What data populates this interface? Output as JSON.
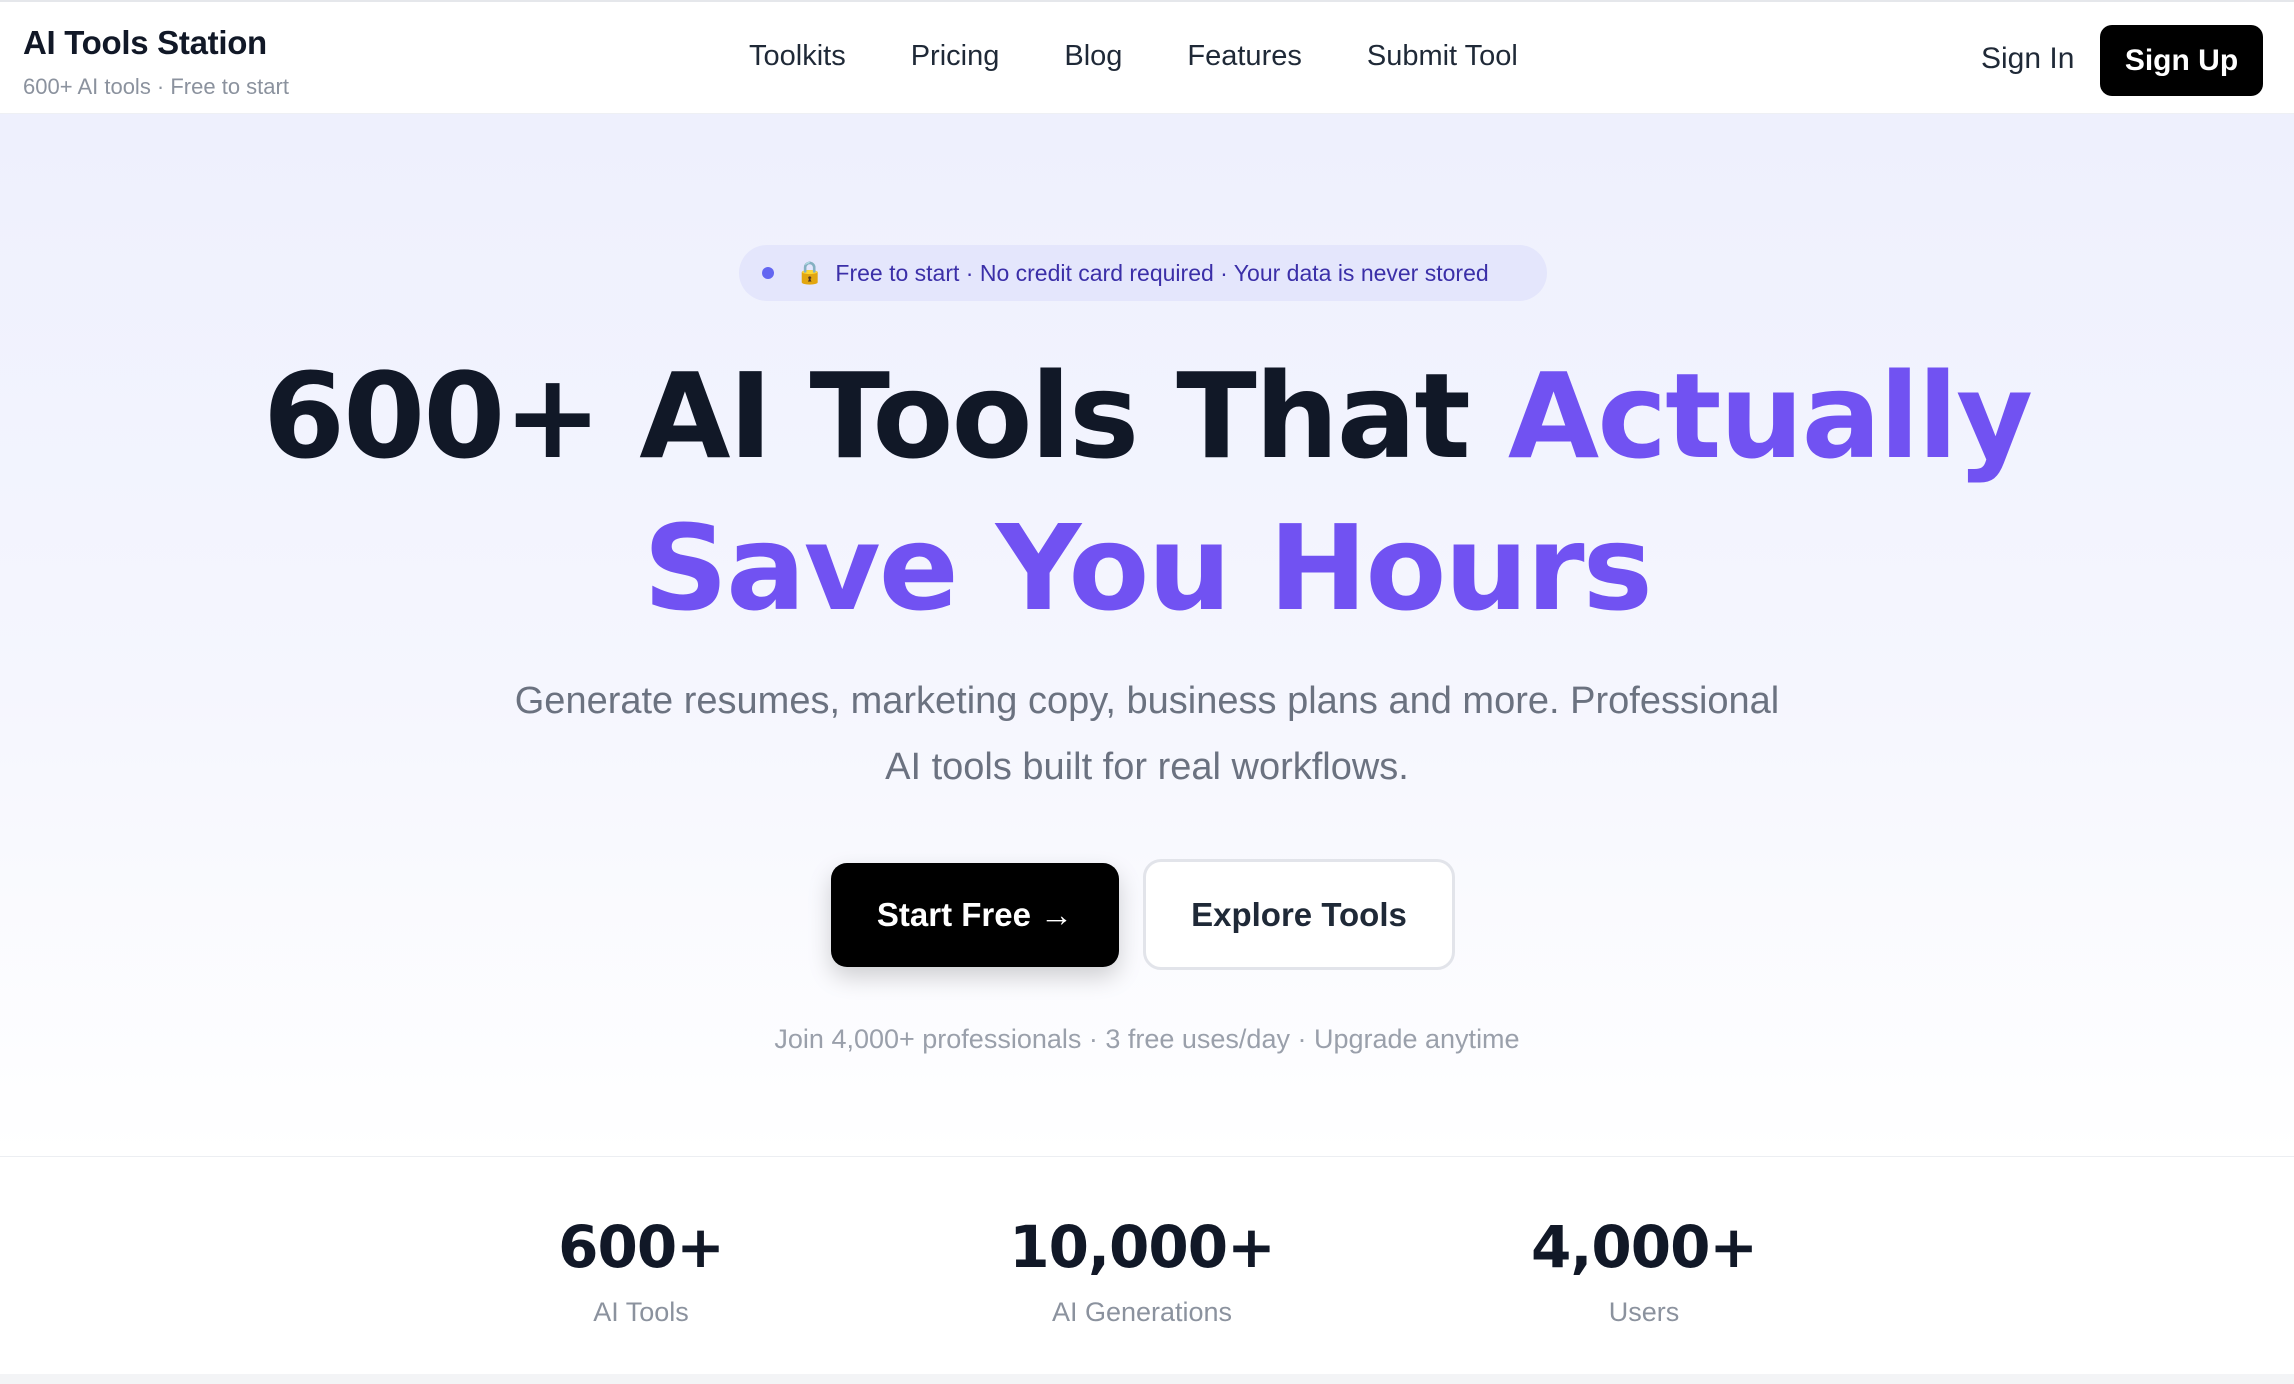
{
  "brand": {
    "title": "AI Tools Station",
    "subtitle": "600+ AI tools · Free to start"
  },
  "nav": {
    "items": [
      "Toolkits",
      "Pricing",
      "Blog",
      "Features",
      "Submit Tool"
    ]
  },
  "auth": {
    "sign_in": "Sign In",
    "sign_up": "Sign Up"
  },
  "hero": {
    "badge": "Free to start · No credit card required · Your data is never stored",
    "badge_icon": "lock-icon",
    "headline_part1": "600+ AI Tools That ",
    "headline_accent1": "Actually",
    "headline_accent2": "Save You Hours",
    "subtitle_line1": "Generate resumes, marketing copy, business plans and more. Professional",
    "subtitle_line2": "AI tools built for real workflows.",
    "cta_primary": "Start Free →",
    "cta_secondary": "Explore Tools",
    "social_proof": "Join 4,000+ professionals · 3 free uses/day · Upgrade anytime"
  },
  "stats": [
    {
      "value": "600+",
      "label": "AI Tools"
    },
    {
      "value": "10,000+",
      "label": "AI Generations"
    },
    {
      "value": "4,000+",
      "label": "Users"
    }
  ],
  "colors": {
    "accent": "#7152f2",
    "primary_button": "#000000",
    "hero_bg": "#eef0fd",
    "badge_bg": "#e4e6fc"
  }
}
